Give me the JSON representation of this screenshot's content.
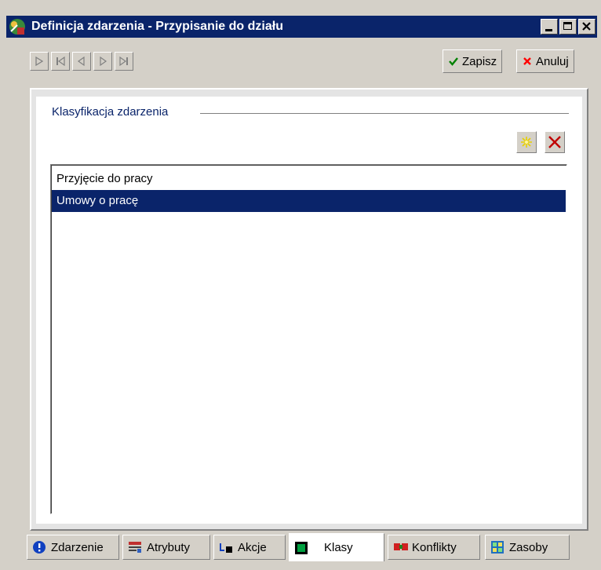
{
  "window": {
    "title": "Definicja zdarzenia - Przypisanie do działu",
    "controls": {
      "minimize": "_",
      "maximize": "□",
      "close": "✕"
    }
  },
  "toolbar": {
    "nav_icons": [
      "new-record-icon",
      "first-record-icon",
      "previous-record-icon",
      "next-record-icon",
      "last-record-icon"
    ],
    "save_label": "Zapisz",
    "cancel_label": "Anuluj",
    "save_color": "#008000",
    "cancel_color": "#ff0000"
  },
  "section": {
    "label": "Klasyfikacja zdarzenia",
    "add_icon": "add-sparkle-icon",
    "delete_icon": "delete-x-icon"
  },
  "list": {
    "items": [
      {
        "label": "Przyjęcie do pracy",
        "selected": false
      },
      {
        "label": "Umowy o pracę",
        "selected": true
      }
    ]
  },
  "tabs": [
    {
      "label": "Zdarzenie",
      "icon": "info-icon",
      "active": false
    },
    {
      "label": "Atrybuty",
      "icon": "attributes-icon",
      "active": false
    },
    {
      "label": "Akcje",
      "icon": "actions-icon",
      "active": false
    },
    {
      "label": "Klasy",
      "icon": "classes-icon",
      "active": true
    },
    {
      "label": "Konflikty",
      "icon": "conflicts-icon",
      "active": false
    },
    {
      "label": "Zasoby",
      "icon": "resources-icon",
      "active": false
    }
  ],
  "colors": {
    "titlebar": "#0a246a",
    "selection": "#0a246a",
    "face": "#d4d0c8"
  }
}
